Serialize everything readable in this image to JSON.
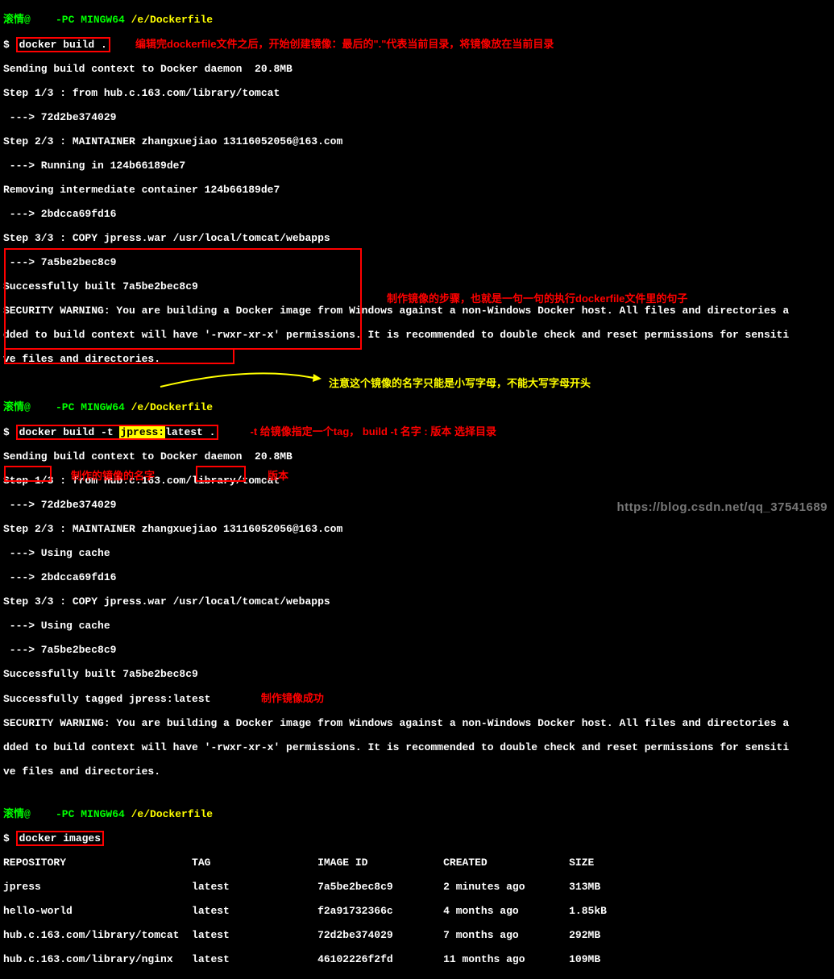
{
  "prompt1": {
    "user": "滚情@    -PC MINGW64",
    "path": " /e/Dockerfile",
    "dollar": "$ ",
    "cmd": "docker build ."
  },
  "anno1": "编辑完dockerfile文件之后，开始创建镜像：最后的\".\"代表当前目录，将镜像放在当前目录",
  "out1": {
    "l1": "Sending build context to Docker daemon  20.8MB",
    "l2": "Step 1/3 : from hub.c.163.com/library/tomcat",
    "l3": " ---> 72d2be374029",
    "l4": "Step 2/3 : MAINTAINER zhangxuejiao 13116052056@163.com",
    "l5": " ---> Running in 124b66189de7",
    "l6": "Removing intermediate container 124b66189de7",
    "l7": " ---> 2bdcca69fd16",
    "l8": "Step 3/3 : COPY jpress.war /usr/local/tomcat/webapps",
    "l9": " ---> 7a5be2bec8c9",
    "l10": "Successfully built 7a5be2bec8c9",
    "l11": "SECURITY WARNING: You are building a Docker image from Windows against a non-Windows Docker host. All files and directories a",
    "l12": "dded to build context will have '-rwxr-xr-x' permissions. It is recommended to double check and reset permissions for sensiti",
    "l13": "ve files and directories."
  },
  "anno2": "注意这个镜像的名字只能是小写字母，不能大写字母开头",
  "prompt2": {
    "user": "滚情@    -PC MINGW64",
    "path": " /e/Dockerfile",
    "dollar": "$ ",
    "cmd_a": "docker build -t ",
    "cmd_b": "jpress:",
    "cmd_c": "latest ."
  },
  "anno3": "-t 给镜像指定一个tag， build -t 名字 : 版本 选择目录",
  "out2": {
    "l1": "Sending build context to Docker daemon  20.8MB",
    "l2": "Step 1/3 : from hub.c.163.com/library/tomcat",
    "l3": " ---> 72d2be374029",
    "l4": "Step 2/3 : MAINTAINER zhangxuejiao 13116052056@163.com",
    "l5": " ---> Using cache",
    "l6": " ---> 2bdcca69fd16",
    "l7": "Step 3/3 : COPY jpress.war /usr/local/tomcat/webapps",
    "l8": " ---> Using cache",
    "l9": " ---> 7a5be2bec8c9",
    "l10": "Successfully built 7a5be2bec8c9",
    "l11": "Successfully tagged jpress:latest",
    "l12": "SECURITY WARNING: You are building a Docker image from Windows against a non-Windows Docker host. All files and directories a",
    "l13": "dded to build context will have '-rwxr-xr-x' permissions. It is recommended to double check and reset permissions for sensiti",
    "l14": "ve files and directories."
  },
  "anno4": "制作镜像的步骤，也就是一句一句的执行dockerfile文件里的句子",
  "anno5": "制作镜像成功",
  "prompt3": {
    "user": "滚情@    -PC MINGW64",
    "path": " /e/Dockerfile",
    "dollar": "$ ",
    "cmd": "docker images"
  },
  "table": {
    "header": "REPOSITORY                    TAG                 IMAGE ID            CREATED             SIZE",
    "r1": "jpress                        latest              7a5be2bec8c9        2 minutes ago       313MB",
    "r2": "hello-world                   latest              f2a91732366c        4 months ago        1.85kB",
    "r3": "hub.c.163.com/library/tomcat  latest              72d2be374029        7 months ago        292MB",
    "r4": "hub.c.163.com/library/nginx   latest              46102226f2fd        11 months ago       109MB"
  },
  "anno6": "制作的镜像的名字",
  "anno7": "版本",
  "watermark": "https://blog.csdn.net/qq_37541689"
}
